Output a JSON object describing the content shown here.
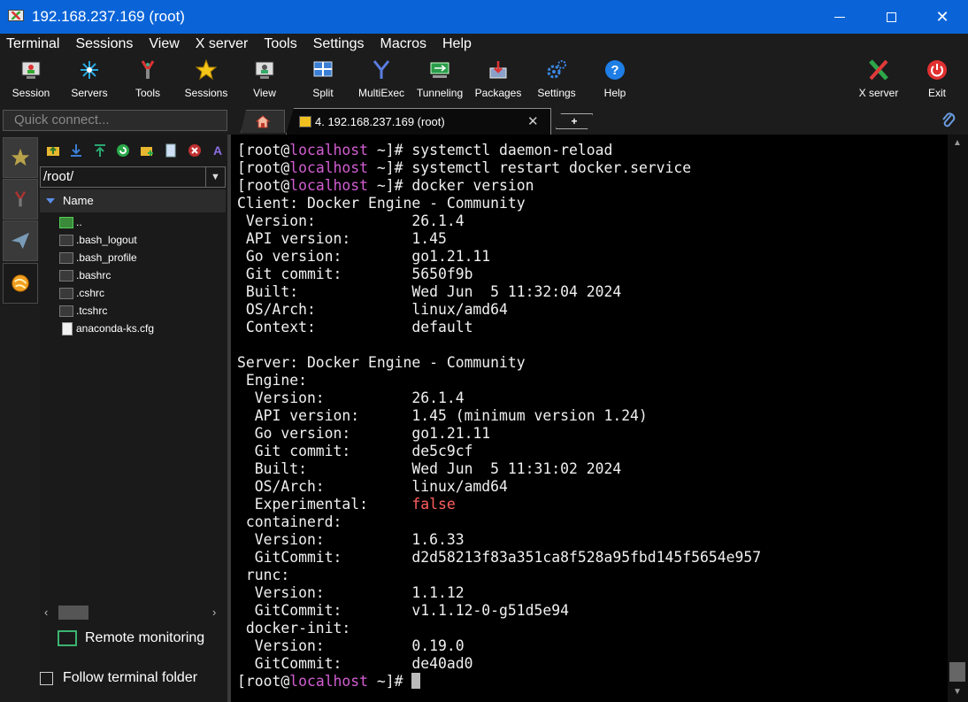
{
  "window": {
    "title": "192.168.237.169 (root)"
  },
  "menu": [
    "Terminal",
    "Sessions",
    "View",
    "X server",
    "Tools",
    "Settings",
    "Macros",
    "Help"
  ],
  "toolbar": [
    {
      "label": "Session",
      "icon": "session-icon"
    },
    {
      "label": "Servers",
      "icon": "servers-icon"
    },
    {
      "label": "Tools",
      "icon": "tools-icon"
    },
    {
      "label": "Sessions",
      "icon": "sessions-star-icon"
    },
    {
      "label": "View",
      "icon": "view-icon"
    },
    {
      "label": "Split",
      "icon": "split-icon"
    },
    {
      "label": "MultiExec",
      "icon": "multiexec-icon"
    },
    {
      "label": "Tunneling",
      "icon": "tunneling-icon"
    },
    {
      "label": "Packages",
      "icon": "packages-icon"
    },
    {
      "label": "Settings",
      "icon": "settings-gear-icon"
    },
    {
      "label": "Help",
      "icon": "help-icon"
    },
    {
      "label": "X server",
      "icon": "xserver-icon"
    },
    {
      "label": "Exit",
      "icon": "exit-power-icon"
    }
  ],
  "quick_connect": {
    "placeholder": "Quick connect..."
  },
  "tabs": {
    "active": {
      "label": "4. 192.168.237.169 (root)",
      "close": "✕"
    },
    "new_tab": "+"
  },
  "sidebar": {
    "path": "/root/",
    "column_header": "Name",
    "files": [
      "..",
      ".bash_logout",
      ".bash_profile",
      ".bashrc",
      ".cshrc",
      ".tcshrc",
      "anaconda-ks.cfg"
    ],
    "remote_monitoring": "Remote monitoring",
    "follow_terminal_folder": "Follow terminal folder"
  },
  "terminal": {
    "prompt_user": "root",
    "prompt_host": "localhost",
    "prompt_dir": "~",
    "commands": [
      "systemctl daemon-reload",
      "systemctl restart docker.service",
      "docker version"
    ],
    "output": [
      "Client: Docker Engine - Community",
      " Version:           26.1.4",
      " API version:       1.45",
      " Go version:        go1.21.11",
      " Git commit:        5650f9b",
      " Built:             Wed Jun  5 11:32:04 2024",
      " OS/Arch:           linux/amd64",
      " Context:           default",
      "",
      "Server: Docker Engine - Community",
      " Engine:",
      "  Version:          26.1.4",
      "  API version:      1.45 (minimum version 1.24)",
      "  Go version:       go1.21.11",
      "  Git commit:       de5c9cf",
      "  Built:            Wed Jun  5 11:31:02 2024",
      "  OS/Arch:          linux/amd64",
      "  Experimental:     ",
      " containerd:",
      "  Version:          1.6.33",
      "  GitCommit:        d2d58213f83a351ca8f528a95fbd145f5654e957",
      " runc:",
      "  Version:          1.1.12",
      "  GitCommit:        v1.1.12-0-g51d5e94",
      " docker-init:",
      "  Version:          0.19.0",
      "  GitCommit:        de40ad0"
    ],
    "experimental_value": "false",
    "colors": {
      "host": "#d25ed2",
      "false_value": "#ff5f5f"
    }
  }
}
